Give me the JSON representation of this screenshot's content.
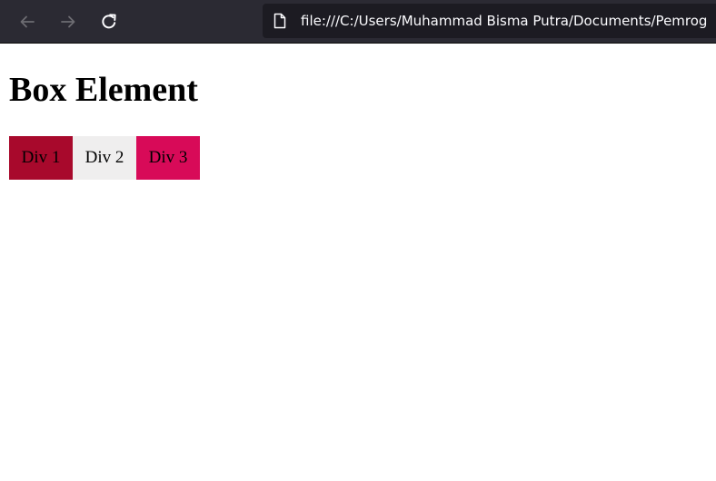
{
  "browser": {
    "url": "file:///C:/Users/Muhammad Bisma Putra/Documents/Pemrog",
    "icons": {
      "back": "arrow-left-icon",
      "forward": "arrow-right-icon",
      "reload": "reload-icon",
      "page": "page-icon"
    },
    "colors": {
      "toolbar": "#2b2a33",
      "urlbar": "#1c1b22",
      "url_text": "#fbfbfe"
    }
  },
  "page": {
    "title": "Box Element",
    "boxes": [
      {
        "label": "Div 1",
        "color": "#a8092c"
      },
      {
        "label": "Div 2",
        "color": "#efeeee"
      },
      {
        "label": "Div 3",
        "color": "#d80a58"
      }
    ]
  }
}
